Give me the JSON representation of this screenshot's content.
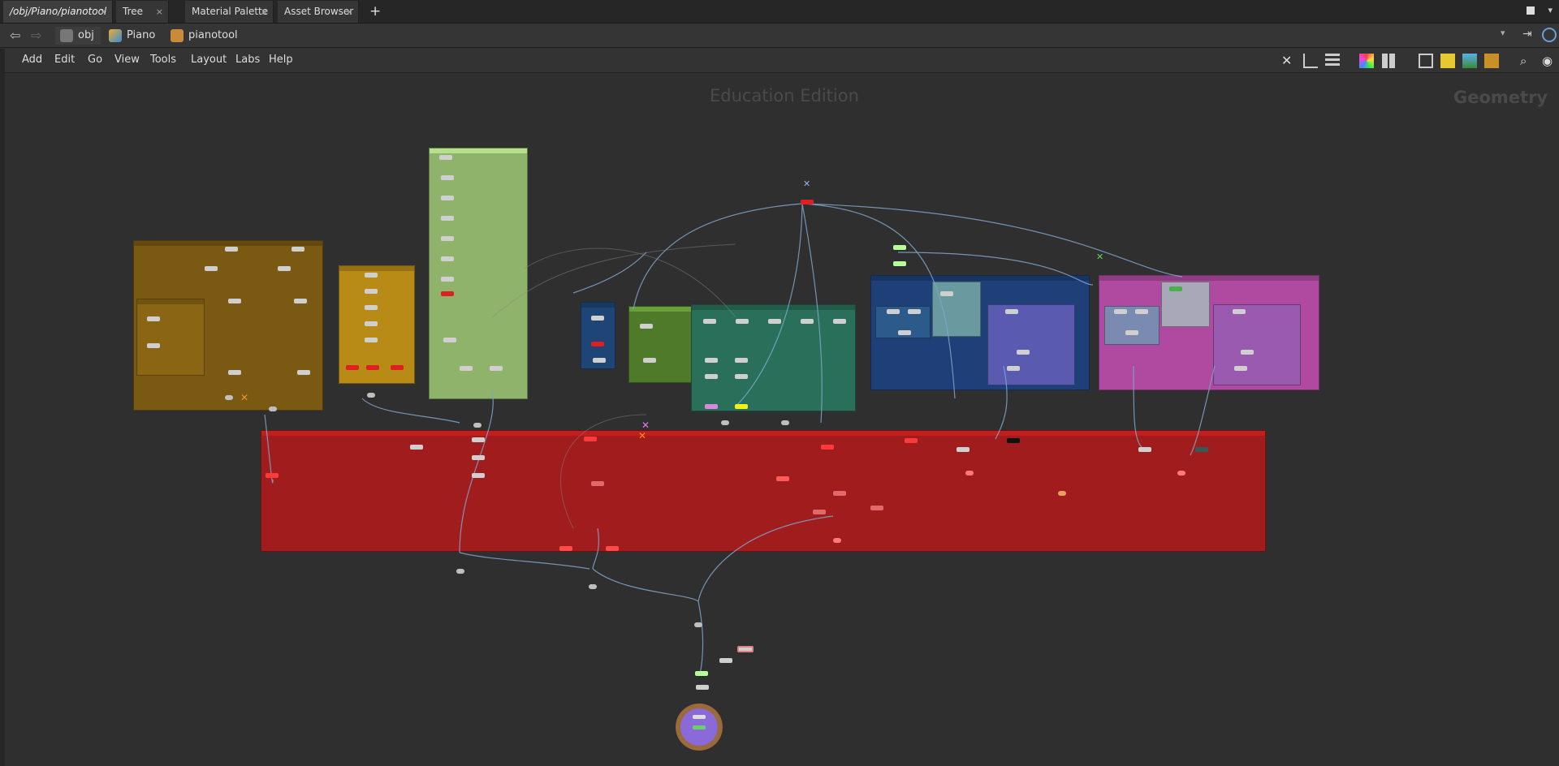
{
  "tabs": [
    {
      "label": "/obj/Piano/pianotool",
      "close": "×"
    },
    {
      "label": "Tree View",
      "close": "×"
    },
    {
      "label": "Material Palette",
      "close": "×"
    },
    {
      "label": "Asset Browser",
      "close": "×"
    }
  ],
  "add_tab": "+",
  "path": {
    "items": [
      {
        "label": "obj",
        "icon": "network-icon"
      },
      {
        "label": "Piano",
        "icon": "object-icon"
      },
      {
        "label": "pianotool",
        "icon": "geometry-icon"
      }
    ]
  },
  "menu": [
    "Add",
    "Edit",
    "Go",
    "View",
    "Tools",
    "Layout",
    "Labs",
    "Help"
  ],
  "toolbar_icons": [
    "wrench-icon",
    "tree-icon",
    "list-icon",
    "palette-icon",
    "grid-icon",
    "network-view-icon",
    "sticky-note-icon",
    "image-icon",
    "box-icon",
    "search-icon",
    "eye-icon"
  ],
  "canvas": {
    "watermark_edition": "Education Edition",
    "watermark_context": "Geometry"
  },
  "colors": {
    "net_bg": "#2f2f2f",
    "box_brown": "#7a5a12",
    "box_yellow": "#b88a16",
    "box_green_light": "#8fb36a",
    "box_blue": "#1f4577",
    "box_green": "#4f7a2a",
    "box_teal": "#2a6f5a",
    "box_navy": "#1f3f78",
    "box_pink": "#b04aa0",
    "box_red": "#a11c1c",
    "wire": "#7fa6cc"
  }
}
